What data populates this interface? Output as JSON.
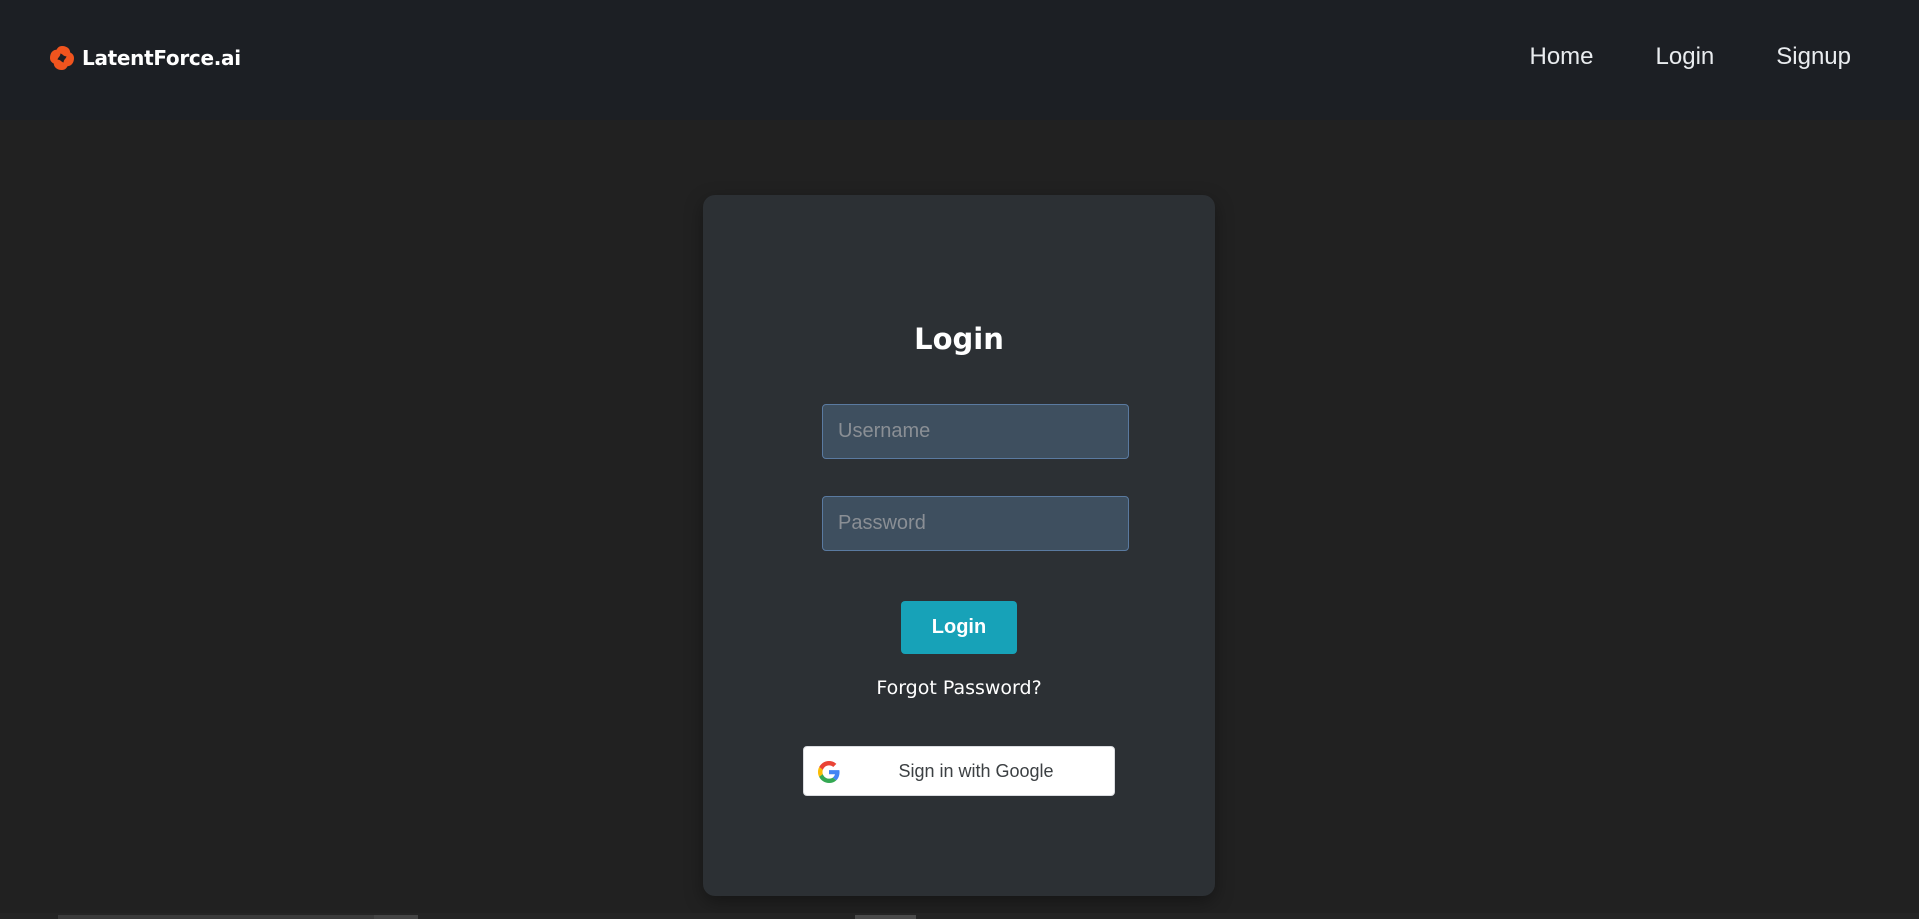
{
  "brand": {
    "name": "LatentForce.ai",
    "logo_icon": "swirl-logo-icon",
    "logo_color": "#f0541e"
  },
  "nav": {
    "items": [
      {
        "label": "Home"
      },
      {
        "label": "Login"
      },
      {
        "label": "Signup"
      }
    ]
  },
  "login_form": {
    "title": "Login",
    "username": {
      "placeholder": "Username",
      "value": ""
    },
    "password": {
      "placeholder": "Password",
      "value": ""
    },
    "submit_label": "Login",
    "forgot_label": "Forgot Password?",
    "google_label": "Sign in with Google",
    "accent_color": "#17a2b8"
  }
}
